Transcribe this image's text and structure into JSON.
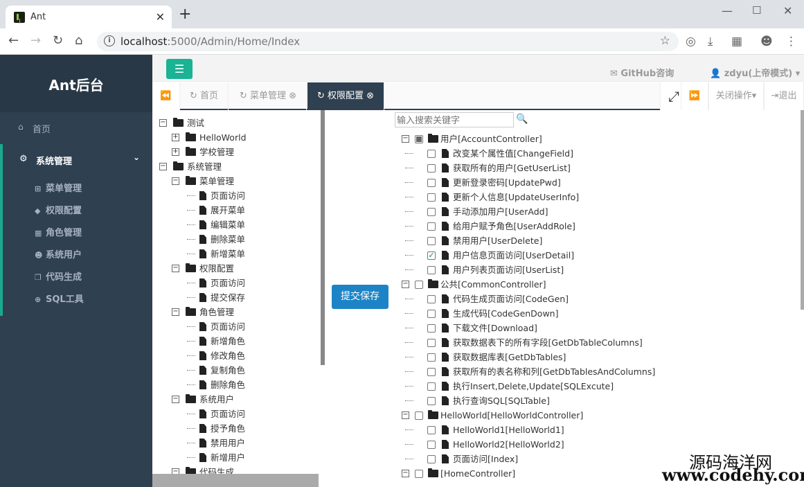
{
  "browser": {
    "tab_title": "Ant",
    "url_host": "localhost",
    "url_path": ":5000/Admin/Home/Index"
  },
  "sidebar": {
    "brand": "Ant后台",
    "home": "首页",
    "system": "系统管理",
    "items": [
      "菜单管理",
      "权限配置",
      "角色管理",
      "系统用户",
      "代码生成",
      "SQL工具"
    ]
  },
  "header": {
    "github": "GitHub咨询",
    "user": "zdyu(上帝模式)"
  },
  "tabs": {
    "items": [
      "首页",
      "菜单管理",
      "权限配置"
    ],
    "close_ops": "关闭操作",
    "logout": "退出"
  },
  "left_tree": {
    "rows": [
      "测试",
      "HelloWorld",
      "学校管理",
      "系统管理",
      "菜单管理",
      "页面访问",
      "展开菜单",
      "编辑菜单",
      "删除菜单",
      "新增菜单",
      "权限配置",
      "页面访问",
      "提交保存",
      "角色管理",
      "页面访问",
      "新增角色",
      "修改角色",
      "复制角色",
      "删除角色",
      "系统用户",
      "页面访问",
      "授予角色",
      "禁用用户",
      "新增用户",
      "代码生成"
    ]
  },
  "save_button": "提交保存",
  "search": {
    "placeholder": "输入搜索关键字"
  },
  "right_tree": {
    "rows": [
      "用户[AccountController]",
      "改变某个属性值[ChangeField]",
      "获取所有的用户[GetUserList]",
      "更新登录密码[UpdatePwd]",
      "更新个人信息[UpdateUserInfo]",
      "手动添加用户[UserAdd]",
      "给用户赋予角色[UserAddRole]",
      "禁用用户[UserDelete]",
      "用户信息页面访问[UserDetail]",
      "用户列表页面访问[UserList]",
      "公共[CommonController]",
      "代码生成页面访问[CodeGen]",
      "生成代码[CodeGenDown]",
      "下载文件[Download]",
      "获取数据表下的所有字段[GetDbTableColumns]",
      "获取数据库表[GetDbTables]",
      "获取所有的表名称和列[GetDbTablesAndColumns]",
      "执行Insert,Delete,Update[SQLExcute]",
      "执行查询SQL[SQLTable]",
      "HelloWorld[HelloWorldController]",
      "HelloWorld1[HelloWorld1]",
      "HelloWorld2[HelloWorld2]",
      "页面访问[Index]",
      "[HomeController]"
    ]
  },
  "watermark": {
    "line1": "源码海洋网",
    "line2": "www.codehy.com"
  },
  "colors": {
    "sidebar": "#2f4050",
    "accent": "#1ab394",
    "primary": "#1c84c6"
  }
}
